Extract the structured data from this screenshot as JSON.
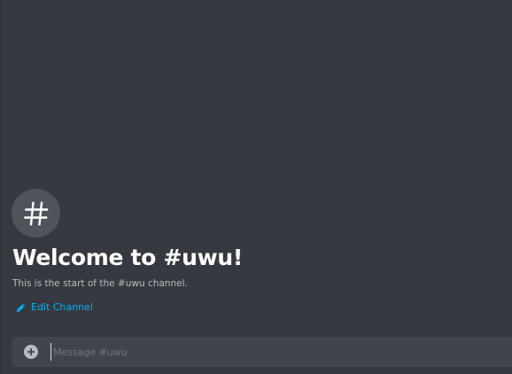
{
  "channel": {
    "icon": "hashtag-icon",
    "welcome_title": "Welcome to #uwu!",
    "welcome_subtitle": "This is the start of the #uwu channel.",
    "edit_label": "Edit Channel",
    "edit_icon": "pencil-icon"
  },
  "composer": {
    "add_icon": "plus-circle-icon",
    "placeholder": "Message #uwu",
    "value": ""
  },
  "colors": {
    "background": "#36393f",
    "accent_link": "#00b0f4",
    "avatar_bg": "#4f545c",
    "composer_bg": "#40444b"
  }
}
